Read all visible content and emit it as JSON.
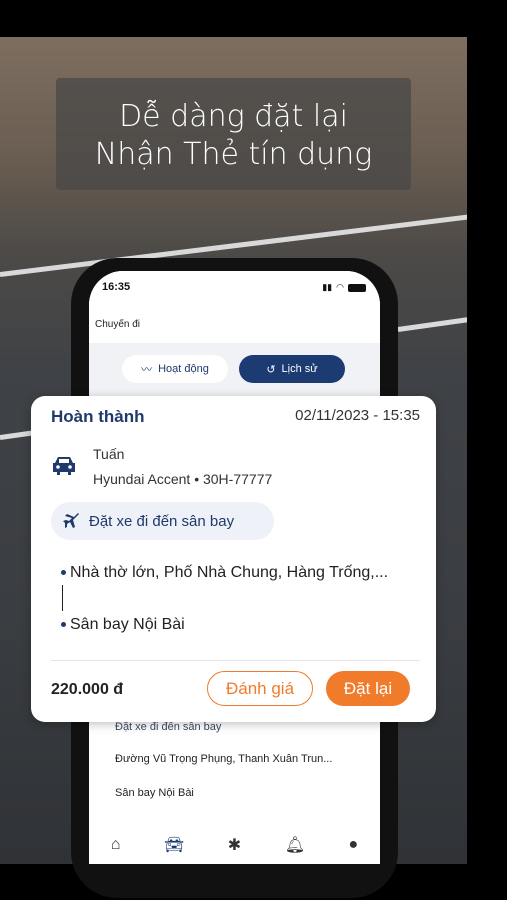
{
  "headline": {
    "line1": "Dễ dàng đặt lại",
    "line2": "Nhận Thẻ tín dụng"
  },
  "phone": {
    "time": "16:35",
    "app_title": "Chuyến đi",
    "segments": {
      "active": "Hoạt động",
      "history": "Lịch sử"
    },
    "background_trip": {
      "tag": "Đặt xe đi đến sân bay",
      "pickup": "Đường Vũ Trọng Phụng, Thanh Xuân Trun...",
      "dropoff": "Sân bay Nội Bài"
    },
    "tabs": [
      "home-icon",
      "car-icon",
      "promo-icon",
      "bell-icon",
      "user-icon"
    ]
  },
  "card": {
    "status": "Hoàn thành",
    "datetime": "02/11/2023 - 15:35",
    "driver": "Tuấn",
    "vehicle": "Hyundai Accent",
    "plate": "30H-77777",
    "trip_type": "Đặt xe đi đến sân bay",
    "pickup": "Nhà thờ lớn, Phố Nhà Chung, Hàng Trống,...",
    "dropoff": "Sân bay Nội Bài",
    "price": "220.000 đ",
    "rate_label": "Đánh giá",
    "rebook_label": "Đặt lại"
  },
  "colors": {
    "accent": "#f07b2b",
    "primary": "#1f3a6b"
  }
}
